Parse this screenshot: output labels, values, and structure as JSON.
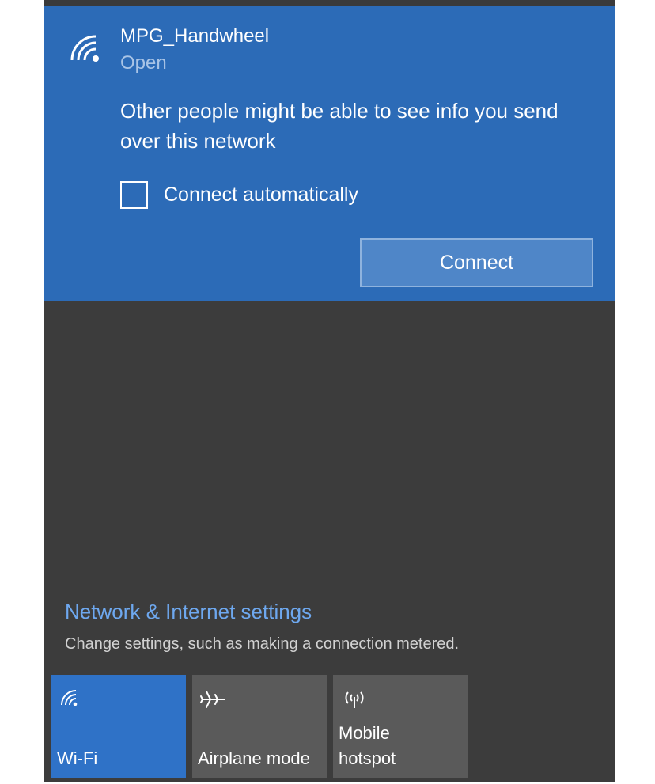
{
  "network": {
    "name": "MPG_Handwheel",
    "status": "Open",
    "warning": "Other people might be able to see info you send over this network",
    "auto_connect_label": "Connect automatically",
    "auto_connect_checked": false,
    "connect_label": "Connect",
    "icon": "wifi-icon"
  },
  "settings": {
    "link_label": "Network & Internet settings",
    "description": "Change settings, such as making a connection metered."
  },
  "quick_actions": [
    {
      "label": "Wi-Fi",
      "icon": "wifi-icon",
      "active": true
    },
    {
      "label": "Airplane mode",
      "icon": "airplane-icon",
      "active": false
    },
    {
      "label_line1": "Mobile",
      "label_line2": "hotspot",
      "icon": "hotspot-icon",
      "active": false
    }
  ],
  "colors": {
    "accent": "#2c6bb7",
    "tile_active": "#2f72c7",
    "tile_inactive": "#5a5a5a",
    "flyout_bg": "#3c3c3c",
    "link": "#6ea8ef"
  }
}
